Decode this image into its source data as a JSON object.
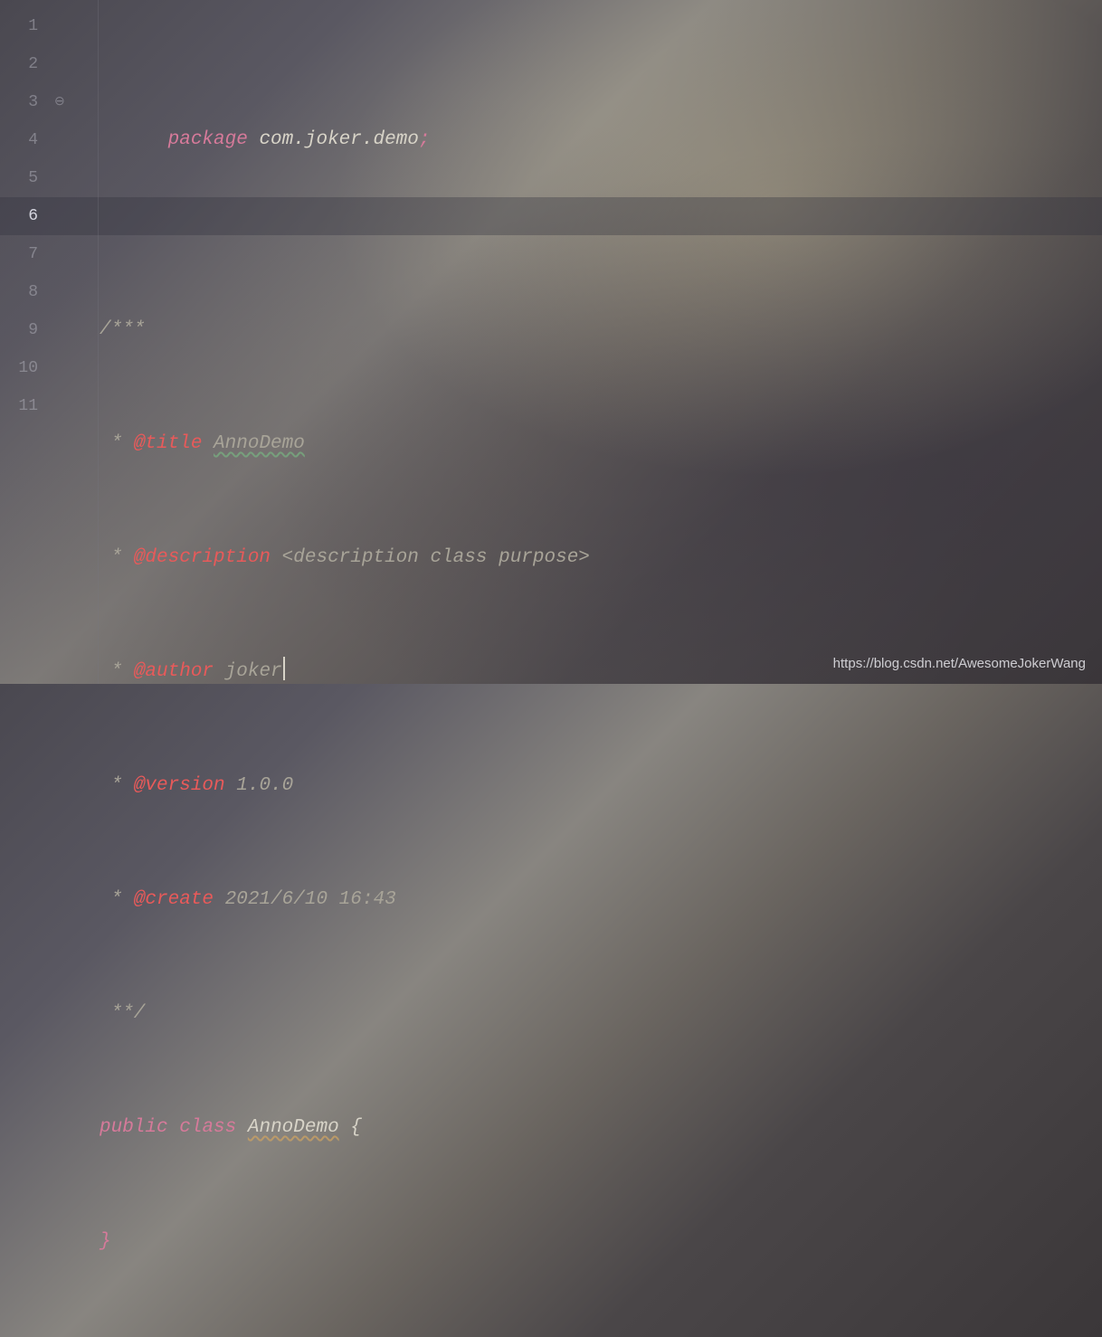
{
  "lines": {
    "numbers": [
      "1",
      "2",
      "3",
      "4",
      "5",
      "6",
      "7",
      "8",
      "9",
      "10",
      "11"
    ],
    "current": 6
  },
  "code": {
    "l1": {
      "kw": "package",
      "pkg": "com.joker.demo",
      "semi": ";"
    },
    "l3": {
      "open": "/***"
    },
    "l4": {
      "star": " * ",
      "tag": "@title",
      "val": "AnnoDemo"
    },
    "l5": {
      "star": " * ",
      "tag": "@description",
      "val": "<description class purpose>"
    },
    "l6": {
      "star": " * ",
      "tag": "@author",
      "val": "joker"
    },
    "l7": {
      "star": " * ",
      "tag": "@version",
      "val": "1.0.0"
    },
    "l8": {
      "star": " * ",
      "tag": "@create",
      "val": "2021/6/10 16:43"
    },
    "l9": {
      "close": " **/"
    },
    "l10": {
      "kw1": "public",
      "kw2": "class",
      "name": "AnnoDemo",
      "brace": "{"
    },
    "l11": {
      "brace": "}"
    }
  },
  "fold": {
    "marker": "⊖"
  },
  "watermark": "https://blog.csdn.net/AwesomeJokerWang"
}
